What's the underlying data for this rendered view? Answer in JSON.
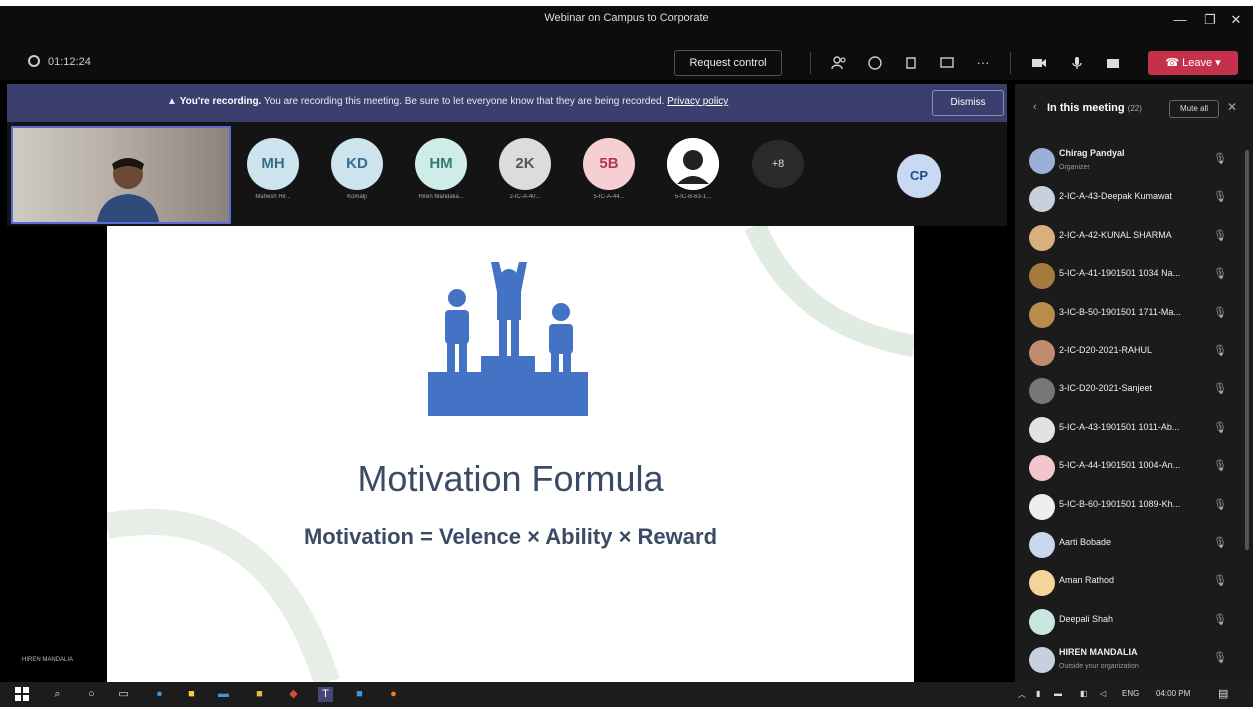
{
  "window": {
    "title": "Webinar on Campus to Corporate",
    "minimize": "—",
    "maximize": "❐",
    "close": "✕"
  },
  "meeting_bar": {
    "timer": "01:12:24",
    "request_control": "Request control",
    "leave": "Leave",
    "icons": [
      "people-icon",
      "chat-icon",
      "reactions-icon",
      "share-icon",
      "more-icon",
      "camera-icon",
      "mic-icon",
      "share-tray-icon"
    ]
  },
  "banner": {
    "bold": "You're recording.",
    "text": " You are recording this meeting. Be sure to let everyone know that they are being recorded.",
    "link": "Privacy policy",
    "dismiss": "Dismiss"
  },
  "participants_strip": [
    {
      "initials": "MH",
      "name": "Mahesh Hir...",
      "bg": "#cde4ee",
      "fg": "#3a6d8a"
    },
    {
      "initials": "KD",
      "name": "Komalji",
      "bg": "#cde4ee",
      "fg": "#3a6d8a"
    },
    {
      "initials": "HM",
      "name": "Hiren Mandalia...",
      "bg": "#cfece8",
      "fg": "#3a7a73"
    },
    {
      "initials": "2K",
      "name": "2-IC-A-40...",
      "bg": "#dcdcdc",
      "fg": "#555555"
    },
    {
      "initials": "5B",
      "name": "5-IC-A-44...",
      "bg": "#f6cfd2",
      "fg": "#b4384a"
    },
    {
      "initials": "",
      "name": "5-IC-B-63-1...",
      "bg": "#ffffff",
      "fg": "#000000"
    }
  ],
  "more_count": "+8",
  "cp_initials": "CP",
  "slide": {
    "title": "Motivation Formula",
    "formula": "Motivation = Velence × Ability × Reward"
  },
  "presenter_label": "HIREN MANDALIA",
  "panel": {
    "title": "In this meeting",
    "count": "(22)",
    "mute_all": "Mute all",
    "participants": [
      {
        "name": "Chirag Pandyal",
        "sub": "Organizer",
        "color": "#9ab0d8"
      },
      {
        "name": "2-IC-A-43-Deepak Kumawat",
        "sub": "",
        "color": "#c7d0dd"
      },
      {
        "name": "2-IC-A-42-KUNAL SHARMA",
        "sub": "",
        "color": "#d9b07a"
      },
      {
        "name": "5-IC-A-41-1901501 1034 Na...",
        "sub": "",
        "color": "#a57a3d"
      },
      {
        "name": "3-IC-B-50-1901501 1711-Ma...",
        "sub": "",
        "color": "#b98c4b"
      },
      {
        "name": "2-IC-D20-2021-RAHUL",
        "sub": "",
        "color": "#c08a6e"
      },
      {
        "name": "3-IC-D20-2021-Sanjeet",
        "sub": "",
        "color": "#777777"
      },
      {
        "name": "5-IC-A-43-1901501 1011-Ab...",
        "sub": "",
        "color": "#e2e2e2"
      },
      {
        "name": "5-IC-A-44-1901501 1004-An...",
        "sub": "",
        "color": "#f1c6cc"
      },
      {
        "name": "5-IC-B-60-1901501 1089-Kh...",
        "sub": "",
        "color": "#eeeeee"
      },
      {
        "name": "Aarti Bobade",
        "sub": "",
        "color": "#c8d7ee"
      },
      {
        "name": "Aman Rathod",
        "sub": "",
        "color": "#f3d59a"
      },
      {
        "name": "Deepali Shah",
        "sub": "",
        "color": "#c9e6e0"
      },
      {
        "name": "HIREN MANDALIA",
        "sub": "Outside your organization",
        "color": "#c7d0dd"
      }
    ]
  },
  "taskbar": {
    "lang": "ENG",
    "time": "04:00 PM"
  }
}
